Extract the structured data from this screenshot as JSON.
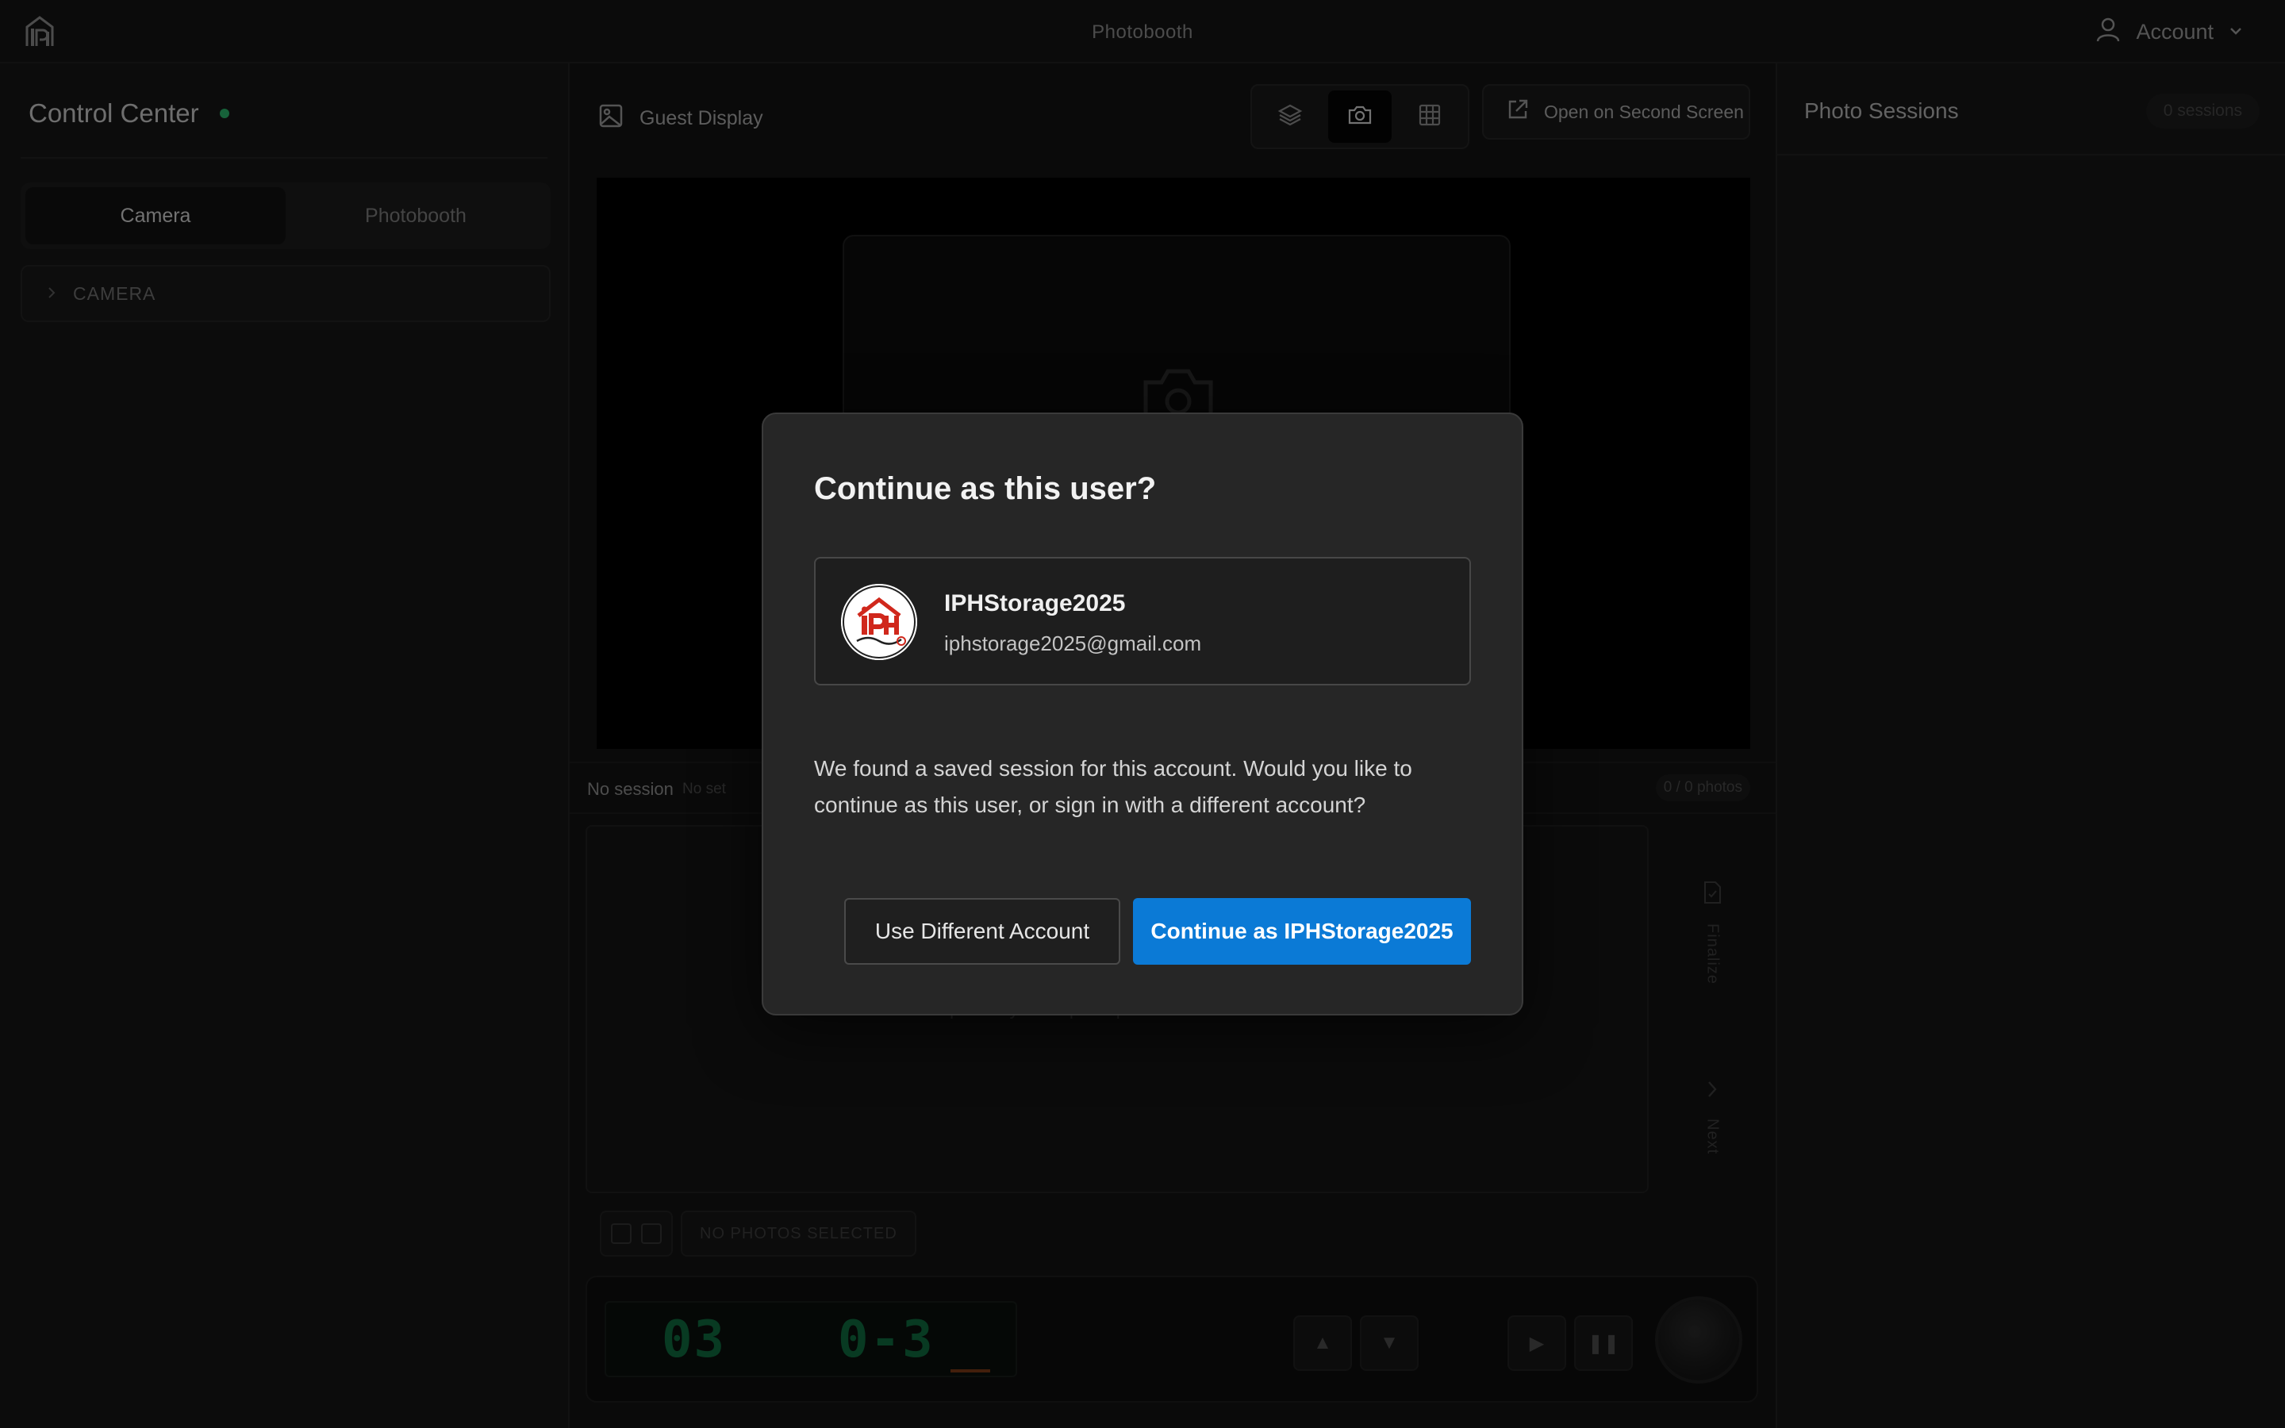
{
  "header": {
    "app_title": "Photobooth",
    "account_label": "Account"
  },
  "left_panel": {
    "title": "Control Center",
    "tabs": [
      {
        "label": "Camera",
        "active": true
      },
      {
        "label": "Photobooth",
        "active": false
      }
    ],
    "section_label": "CAMERA"
  },
  "center": {
    "guest_display_label": "Guest Display",
    "view_modes": [
      "layers-icon",
      "camera-icon",
      "grid-icon"
    ],
    "active_view": "camera-icon",
    "open_second_screen_label": "Open on Second Screen",
    "session_name": "No session",
    "session_set": "No set",
    "photo_count": "0 / 0 photos",
    "gallery_empty_text": "No photos yet - capture photos to see them here",
    "finalize_label": "Finalize",
    "next_label": "Next",
    "no_photos_selected": "NO PHOTOS SELECTED",
    "lcd_left": "03",
    "lcd_right": "0-3"
  },
  "right_panel": {
    "title": "Photo Sessions",
    "session_count": "0 sessions"
  },
  "modal": {
    "title": "Continue as this user?",
    "user_name": "IPHStorage2025",
    "user_email": "iphstorage2025@gmail.com",
    "message": "We found a saved session for this account. Would you like to continue as this user, or sign in with a different account?",
    "secondary_button": "Use Different Account",
    "primary_button": "Continue as IPHStorage2025"
  },
  "colors": {
    "accent": "#0b7ad6",
    "status_online": "#2ab36a",
    "lcd_digits": "#0f6b3e"
  }
}
